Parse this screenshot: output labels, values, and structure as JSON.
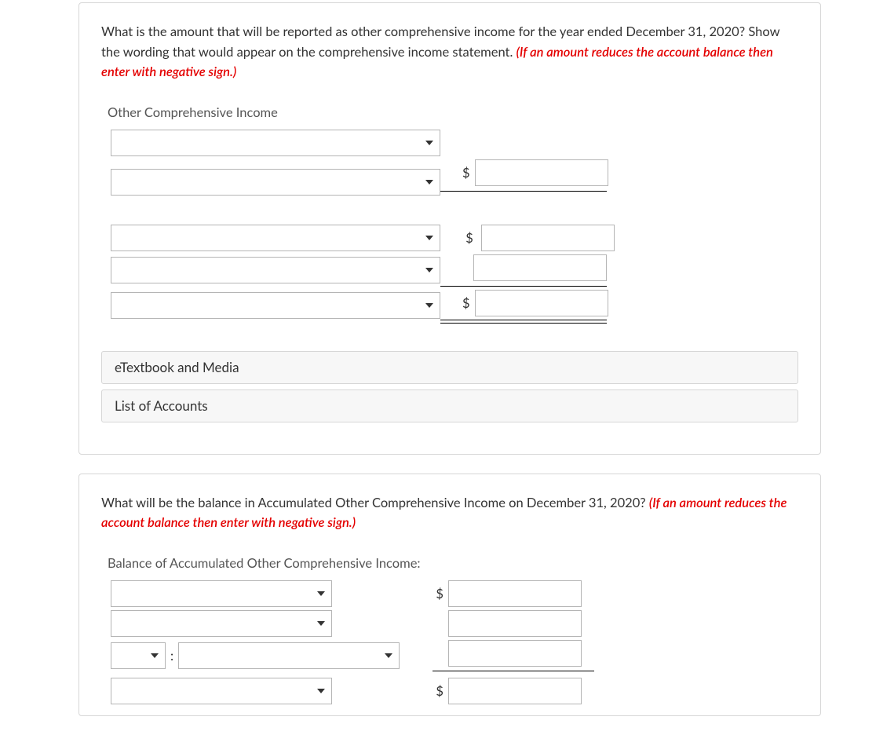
{
  "q1": {
    "text_a": "What is the amount that will be reported as other comprehensive income for the year ended December 31, 2020? Show the wording that would appear on the comprehensive income statement. ",
    "text_b": "(If an amount reduces the account balance then enter with negative sign.)",
    "heading": "Other Comprehensive Income",
    "dollar": "$"
  },
  "panels": {
    "etextbook": "eTextbook and Media",
    "accounts": "List of Accounts"
  },
  "q2": {
    "text_a": "What will be the balance in Accumulated Other Comprehensive Income on December 31, 2020? ",
    "text_b": "(If an amount reduces the account balance then enter with negative sign.)",
    "heading": "Balance of Accumulated Other Comprehensive Income:",
    "colon": ":",
    "dollar": "$"
  }
}
